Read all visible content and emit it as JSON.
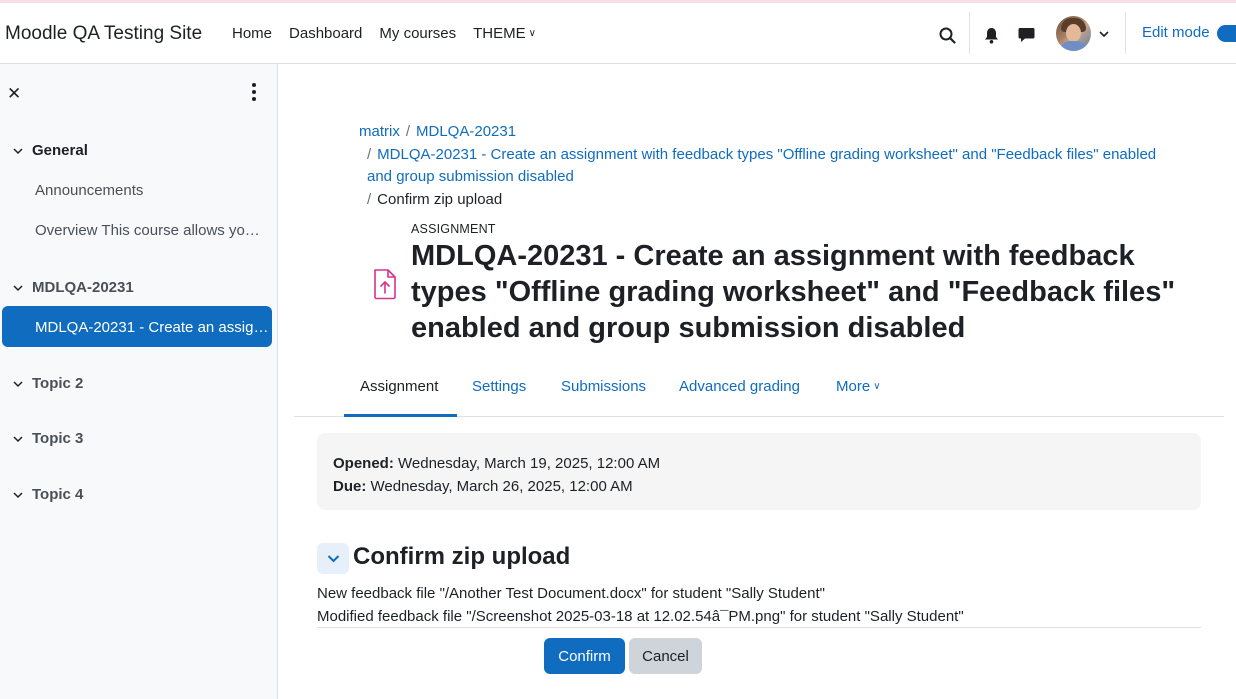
{
  "site": {
    "brand": "Moodle QA Testing Site"
  },
  "nav": {
    "links": [
      "Home",
      "Dashboard",
      "My courses",
      "THEME"
    ],
    "edit_mode_label": "Edit mode"
  },
  "drawer": {
    "sections": [
      {
        "label": "General",
        "items": [
          "Announcements",
          "Overview This course allows you to..."
        ]
      },
      {
        "label": "MDLQA-20231",
        "items": [
          "MDLQA-20231 - Create an assignment with feedback types"
        ]
      },
      {
        "label": "Topic 2",
        "items": []
      },
      {
        "label": "Topic 3",
        "items": []
      },
      {
        "label": "Topic 4",
        "items": []
      }
    ]
  },
  "breadcrumb": {
    "items": [
      "matrix",
      "MDLQA-20231",
      "MDLQA-20231 - Create an assignment with feedback types \"Offline grading worksheet\" and \"Feedback files\" enabled and group submission disabled",
      "Confirm zip upload"
    ]
  },
  "activity": {
    "kicker": "ASSIGNMENT",
    "title": "MDLQA-20231 - Create an assignment with feedback types \"Offline grading worksheet\" and \"Feedback files\" enabled and group submission disabled"
  },
  "tabs": [
    "Assignment",
    "Settings",
    "Submissions",
    "Advanced grading",
    "More"
  ],
  "dates": {
    "opened_label": "Opened:",
    "opened_value": "Wednesday, March 19, 2025, 12:00 AM",
    "due_label": "Due:",
    "due_value": "Wednesday, March 26, 2025, 12:00 AM"
  },
  "confirm": {
    "heading": "Confirm zip upload",
    "messages": [
      "New feedback file \"/Another Test Document.docx\" for student \"Sally Student\"",
      "Modified feedback file \"/Screenshot 2025-03-18 at 12.02.54â¯PM.png\" for student \"Sally Student\""
    ],
    "confirm_label": "Confirm",
    "cancel_label": "Cancel"
  },
  "colors": {
    "primary": "#0f6cbf",
    "assignment_icon": "#d6338b"
  }
}
